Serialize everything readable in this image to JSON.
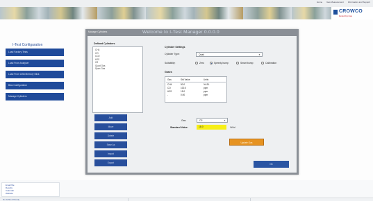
{
  "header": {
    "top_links": [
      "Home",
      "Gas Measurement",
      "Information and Support"
    ],
    "logo_name": "CROWCO",
    "logo_tagline": "Detecting Gas"
  },
  "sidebar": {
    "title": "I-Test Configuration",
    "items": [
      {
        "label": "Load Factory Tests"
      },
      {
        "label": "Load From Analyser"
      },
      {
        "label": "Load From USB Memory Stick"
      },
      {
        "label": "Bias Configuration"
      },
      {
        "label": "Manage Cylinders"
      }
    ]
  },
  "dialog": {
    "caption": "Manage Cylinders",
    "title": "Welcome to I-Test Manager 0.0.0.0",
    "defined_label": "Defined Cylinders",
    "cylinders": [
      "CH4",
      "CO",
      "CO2",
      "H2S",
      "O2",
      "Quad Gas",
      "Span Gas"
    ],
    "buttons": [
      "Add",
      "Move",
      "Delete",
      "Save As",
      "Import",
      "Export"
    ],
    "settings_label": "Cylinder Settings",
    "type_label": "Cylinder Type:",
    "type_value": "Quad",
    "suitability_label": "Suitability:",
    "suitability_options": [
      {
        "label": "Zero",
        "selected": false
      },
      {
        "label": "Speedy bump",
        "selected": true
      },
      {
        "label": "Smart bump",
        "selected": false
      },
      {
        "label": "Calibration",
        "selected": false
      }
    ],
    "gases_label": "Gases",
    "gas_headers": [
      "Gas",
      "Std Value",
      "Units"
    ],
    "gas_rows": [
      [
        "CH4",
        "50.0",
        "%LEL"
      ],
      [
        "CO",
        "100.0",
        "ppm"
      ],
      [
        "H2S",
        "15.0",
        "ppm"
      ],
      [
        "-",
        "0.00",
        "ppm"
      ]
    ],
    "gas_label": "Gas:",
    "gas_value": "O2",
    "std_label": "Standard Value:",
    "std_value": "18.0",
    "std_unit": "%Vol",
    "update_button": "Update Gas",
    "ok_button": "OK"
  },
  "footer": {
    "links": [
      "Email Me",
      "Results",
      "Calendar",
      "Website"
    ],
    "status": "No defined Ready"
  },
  "colors": {
    "nav_blue": "#1f4a9a",
    "accent_orange": "#e69322",
    "highlight_yellow": "#f7ef17",
    "brand_red": "#c8202b"
  }
}
